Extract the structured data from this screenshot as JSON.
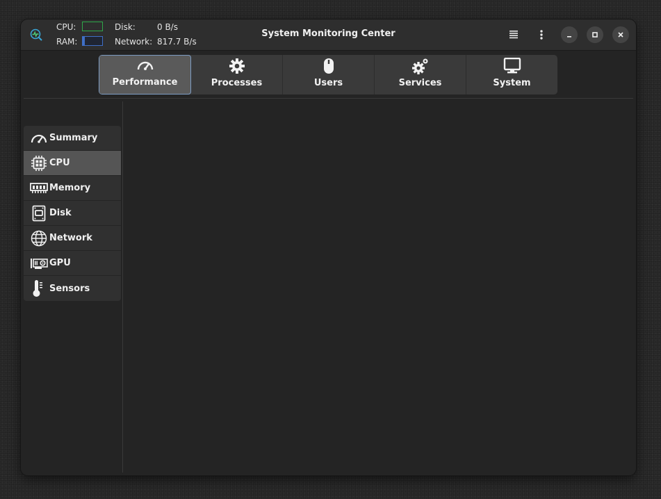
{
  "window": {
    "title": "System Monitoring Center"
  },
  "header_stats": {
    "cpu_label": "CPU:",
    "ram_label": "RAM:",
    "disk_label": "Disk:",
    "disk_value": "0 B/s",
    "network_label": "Network:",
    "network_value": "817.7 B/s",
    "cpu_color": "#2fa84a",
    "ram_color": "#3f6fc6"
  },
  "titlebar_buttons": [
    "hamburger-menu-icon",
    "kebab-menu-icon",
    "minimize-icon",
    "maximize-icon",
    "close-icon"
  ],
  "tabs": [
    {
      "label": "Performance",
      "icon": "gauge-icon",
      "active": true
    },
    {
      "label": "Processes",
      "icon": "gear-icon",
      "active": false
    },
    {
      "label": "Users",
      "icon": "mouse-icon",
      "active": false
    },
    {
      "label": "Services",
      "icon": "gears-icon",
      "active": false
    },
    {
      "label": "System",
      "icon": "monitor-icon",
      "active": false
    }
  ],
  "sidebar": {
    "items": [
      {
        "label": "Summary",
        "icon": "gauge-icon",
        "active": false
      },
      {
        "label": "CPU",
        "icon": "chip-icon",
        "active": true
      },
      {
        "label": "Memory",
        "icon": "memory-icon",
        "active": false
      },
      {
        "label": "Disk",
        "icon": "disk-icon",
        "active": false
      },
      {
        "label": "Network",
        "icon": "globe-icon",
        "active": false
      },
      {
        "label": "GPU",
        "icon": "gpu-icon",
        "active": false
      },
      {
        "label": "Sensors",
        "icon": "thermometer-icon",
        "active": false
      }
    ]
  }
}
